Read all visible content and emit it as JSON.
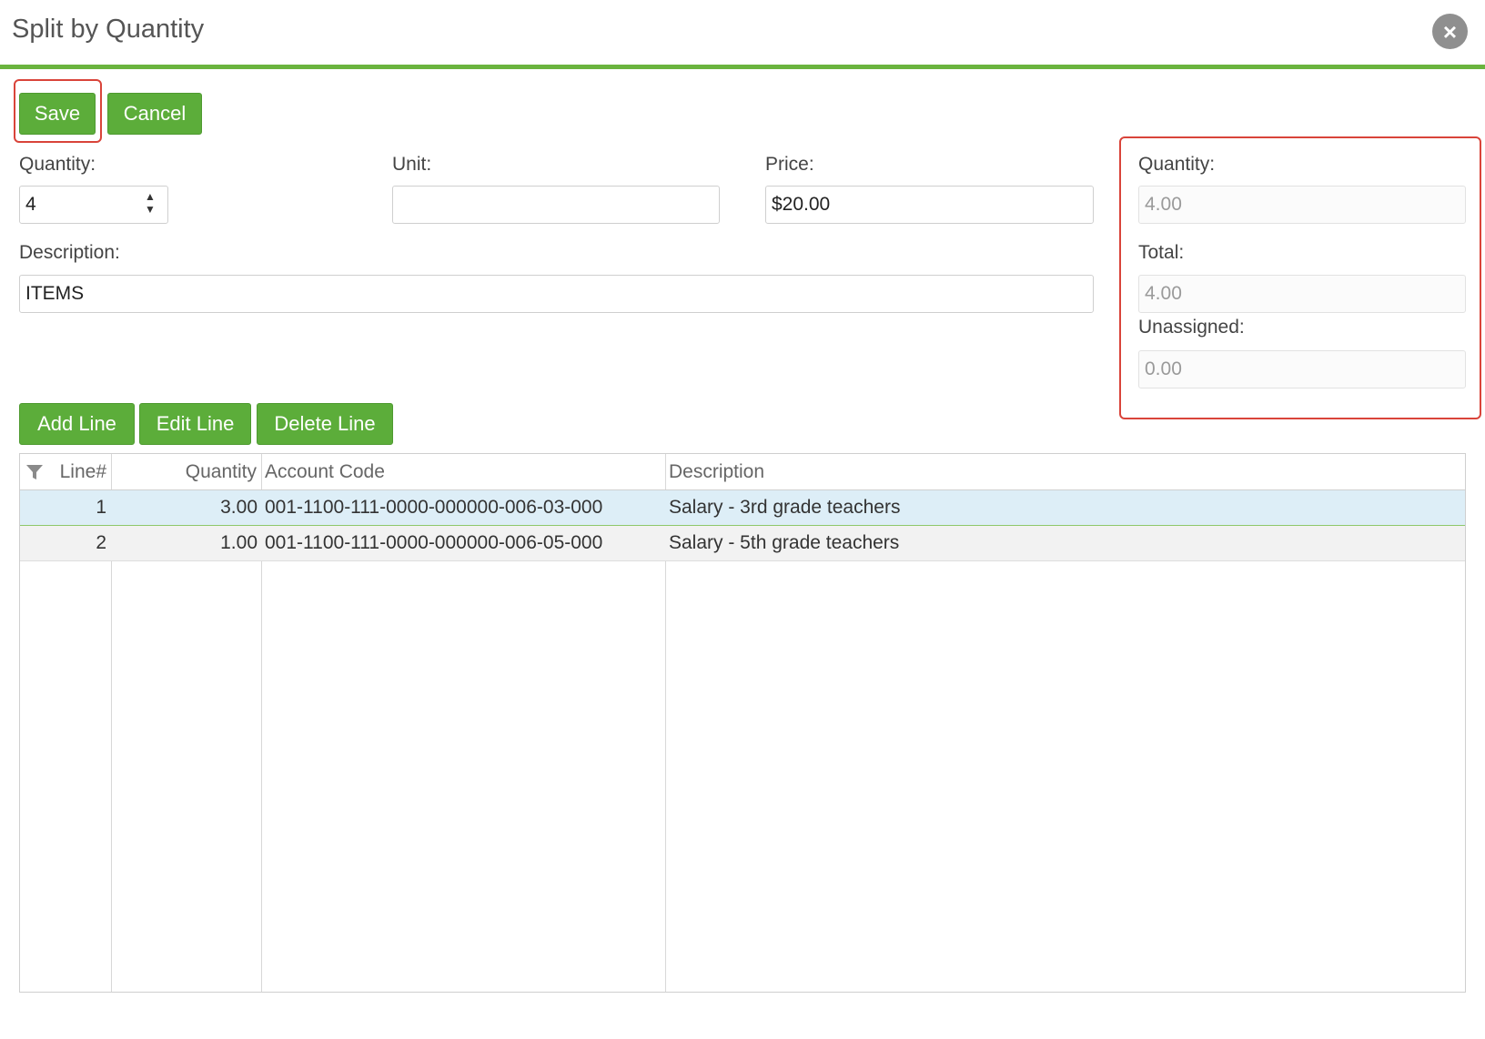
{
  "dialog": {
    "title": "Split by Quantity"
  },
  "toolbar": {
    "save_label": "Save",
    "cancel_label": "Cancel"
  },
  "form": {
    "quantity_label": "Quantity:",
    "quantity_value": "4",
    "unit_label": "Unit:",
    "unit_value": "",
    "price_label": "Price:",
    "price_value": "$20.00",
    "description_label": "Description:",
    "description_value": "ITEMS"
  },
  "summary": {
    "quantity_label": "Quantity:",
    "quantity_value": "4.00",
    "total_label": "Total:",
    "total_value": "4.00",
    "unassigned_label": "Unassigned:",
    "unassigned_value": "0.00"
  },
  "line_actions": {
    "add_label": "Add Line",
    "edit_label": "Edit Line",
    "delete_label": "Delete Line"
  },
  "grid": {
    "columns": [
      "Line#",
      "Quantity",
      "Account Code",
      "Description"
    ],
    "rows": [
      {
        "line": "1",
        "quantity": "3.00",
        "account_code": "001-1100-111-0000-000000-006-03-000",
        "description": "Salary - 3rd grade teachers",
        "selected": true
      },
      {
        "line": "2",
        "quantity": "1.00",
        "account_code": "001-1100-111-0000-000000-006-05-000",
        "description": "Salary - 5th grade teachers",
        "selected": false
      }
    ]
  },
  "colors": {
    "accent_green": "#5cad3a",
    "highlight_red": "#d9443a",
    "selected_row": "#ddeef7"
  },
  "icons": {
    "close": "close-icon",
    "filter": "filter-icon",
    "stepper": "stepper-icon"
  }
}
